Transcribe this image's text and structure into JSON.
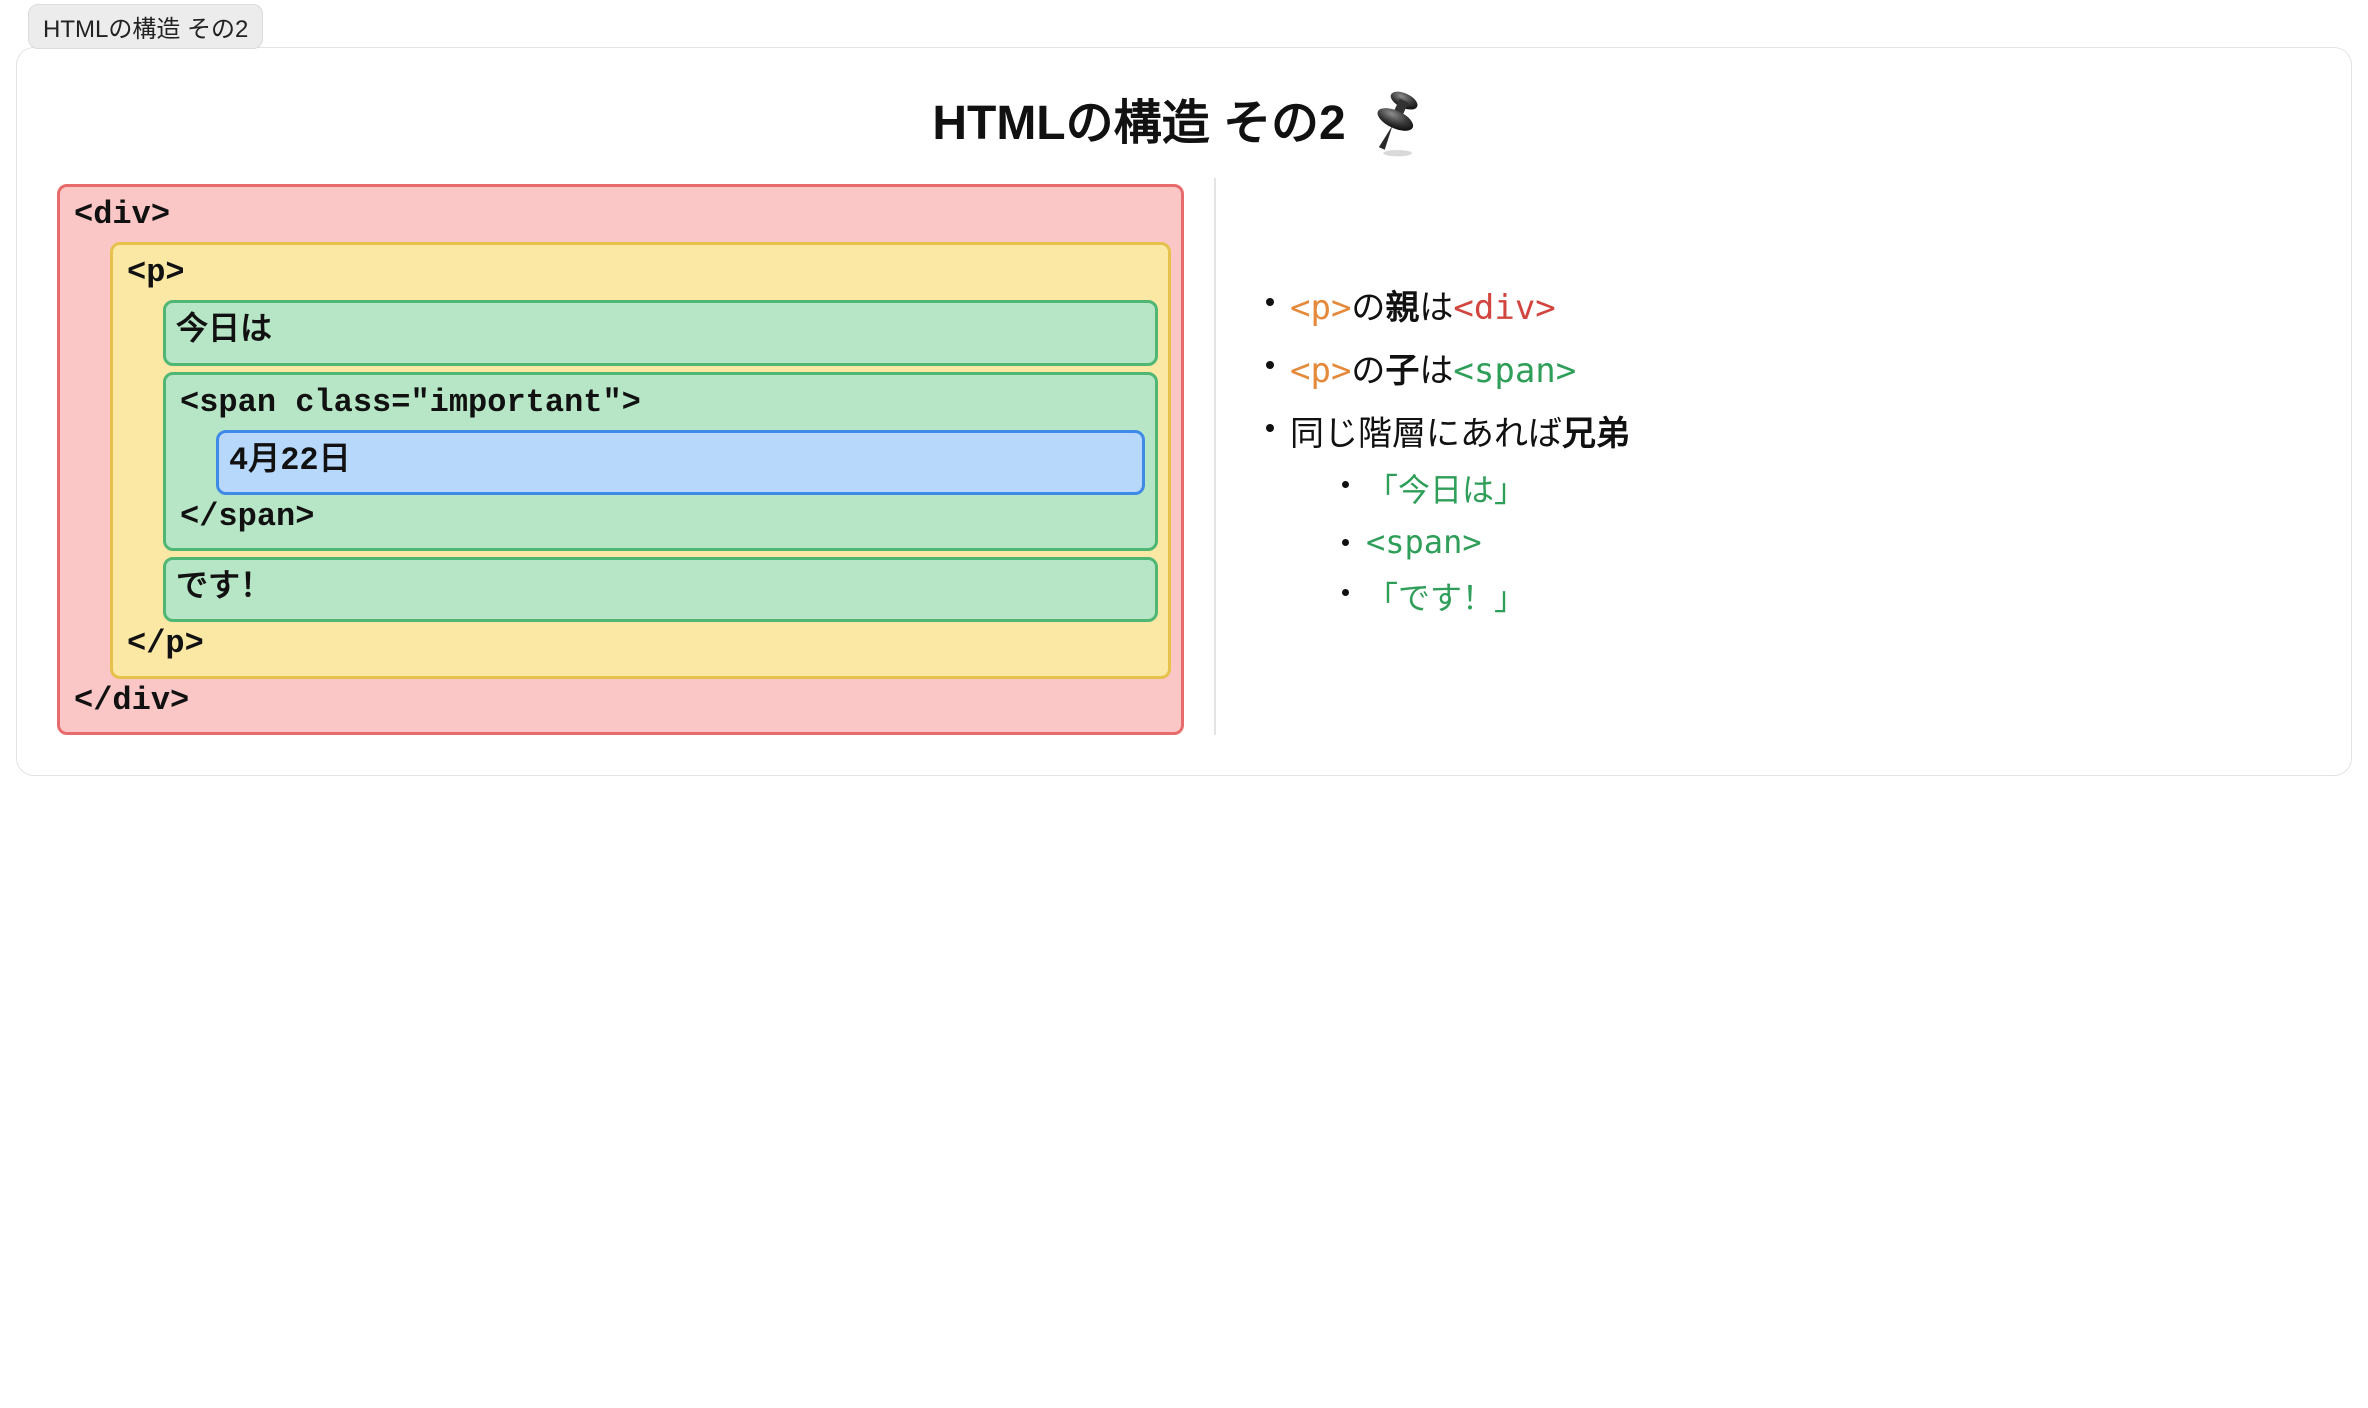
{
  "tab": {
    "label": "HTMLの構造 その2"
  },
  "title": "HTMLの構造 その2",
  "diagram": {
    "div_open": "<div>",
    "div_close": "</div>",
    "p_open": "<p>",
    "p_close": "</p>",
    "text_today": "今日は",
    "span_open": "<span class=\"important\">",
    "span_close": "</span>",
    "date": "4月22日",
    "text_desu": "です！"
  },
  "notes": {
    "b1": {
      "p": "<p>",
      "mid": "の",
      "parent": "親",
      "is": "は",
      "div": "<div>"
    },
    "b2": {
      "p": "<p>",
      "mid": "の",
      "child": "子",
      "is": "は",
      "span": "<span>"
    },
    "b3": {
      "prefix": "同じ階層にあれば",
      "siblings": "兄弟"
    },
    "sub": {
      "s1": "「今日は」",
      "s2": "<span>",
      "s3": "「です！」"
    }
  }
}
